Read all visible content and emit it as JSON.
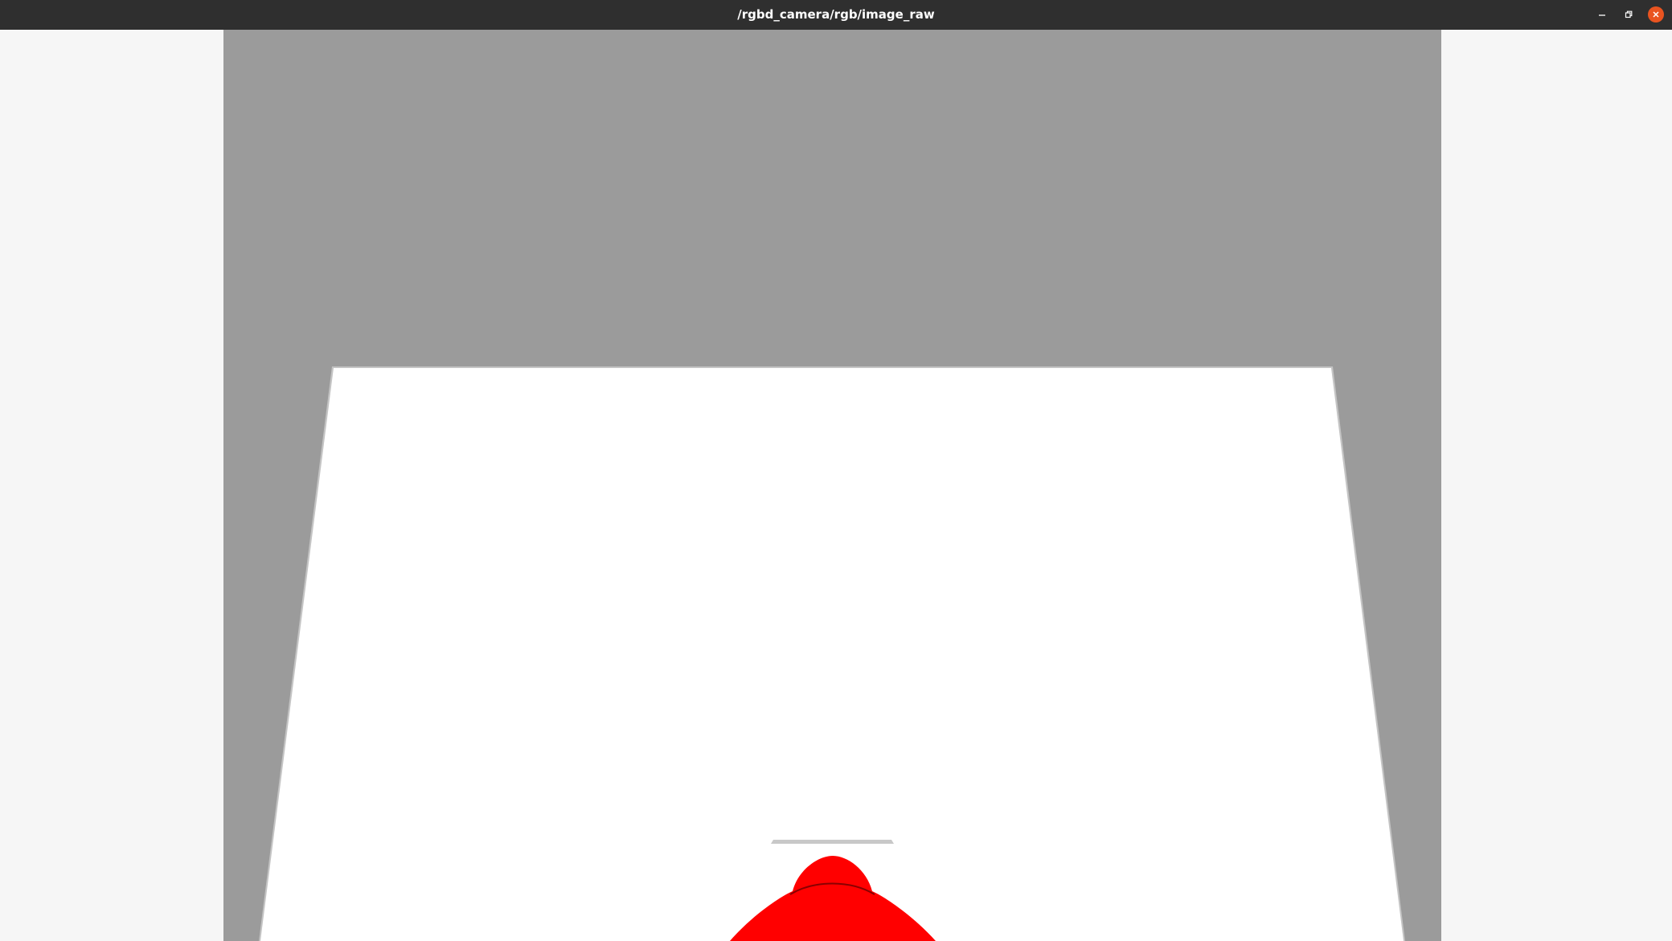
{
  "window": {
    "title": "/rgbd_camera/rgb/image_raw",
    "controls": {
      "minimize_icon": "minimize-icon",
      "maximize_icon": "restore-icon",
      "close_icon": "close-icon"
    }
  },
  "image": {
    "topic": "/rgbd_camera/rgb/image_raw",
    "colors": {
      "background": "#9b9b9b",
      "table": "#ffffff",
      "object": "#ff0000",
      "edge": "#c8c8c8"
    }
  },
  "theme": {
    "titlebar": "#2f2f2f",
    "close_button": "#e95420",
    "window_bg": "#f6f6f6"
  }
}
